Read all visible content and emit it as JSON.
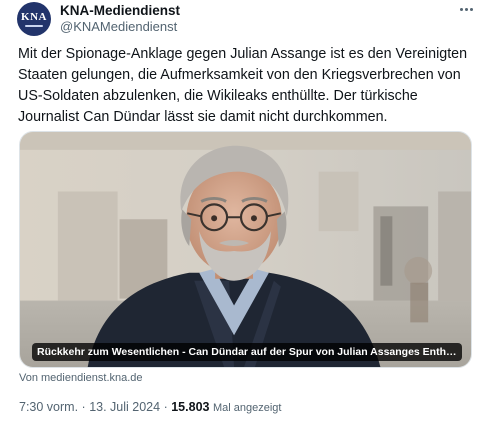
{
  "author": {
    "avatar_text": "KNA",
    "name": "KNA-Mediendienst",
    "handle": "@KNAMediendienst"
  },
  "tweet": {
    "text": "Mit der Spionage-Anklage gegen Julian Assange ist es den Vereinigten Staaten gelungen, die Aufmerksamkeit von den Kriegsverbrechen von US-Soldaten abzulenken, die Wikileaks enthüllte. Der türkische Journalist Can Dündar lässt sie damit nicht durchkommen."
  },
  "card": {
    "title": "Rückkehr zum Wesentlichen - Can Dündar auf der Spur von Julian Assanges Enthüllung...",
    "source": "Von mediendienst.kna.de"
  },
  "meta": {
    "time": "7:30 vorm.",
    "separator": "·",
    "date": "13. Juli 2024",
    "views_count": "15.803",
    "views_label": "Mal angezeigt"
  },
  "colors": {
    "text_primary": "#0f1419",
    "text_secondary": "#536471",
    "avatar_bg": "#22346b"
  },
  "icons": {
    "more": "more-horizontal-icon"
  }
}
